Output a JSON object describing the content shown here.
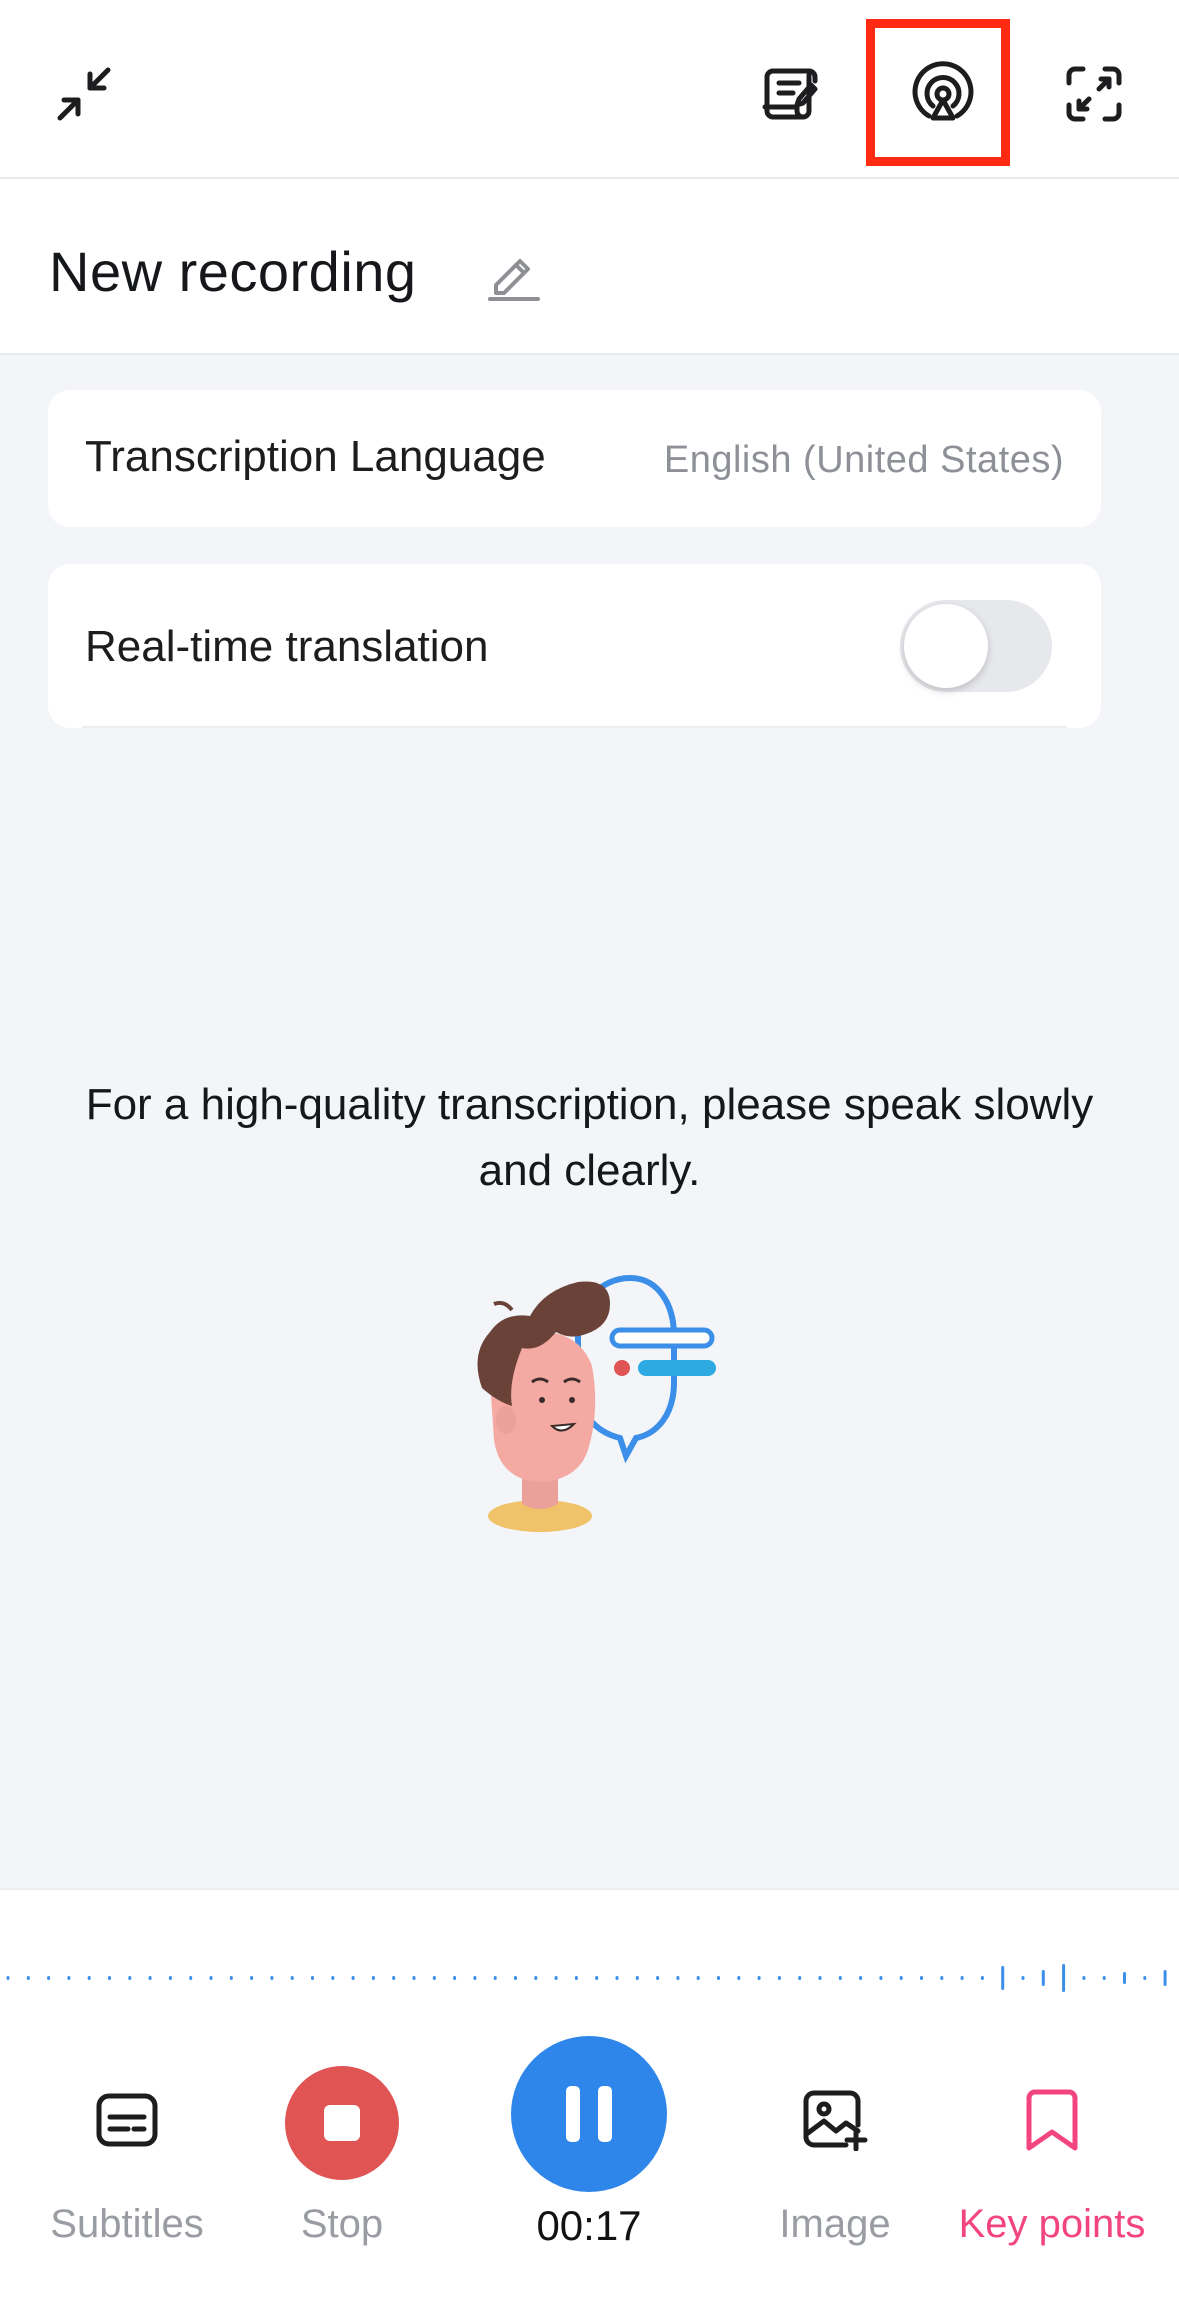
{
  "topbar": {
    "icons": [
      "collapse-icon",
      "notes-icon",
      "live-broadcast-icon",
      "expand-icon"
    ],
    "highlight_color": "#ff2a12"
  },
  "recording": {
    "title": "New recording"
  },
  "settings": {
    "language_label": "Transcription Language",
    "language_value": "English (United States)",
    "translation_label": "Real-time translation",
    "translation_enabled": false
  },
  "hint": {
    "text": "For a high-quality transcription, please speak slowly and clearly."
  },
  "controls": {
    "subtitles_label": "Subtitles",
    "stop_label": "Stop",
    "timer": "00:17",
    "image_label": "Image",
    "keypoints_label": "Key points"
  },
  "colors": {
    "accent_blue": "#2f86ea",
    "stop_red": "#e05454",
    "keypoints_pink": "#f2457d"
  }
}
